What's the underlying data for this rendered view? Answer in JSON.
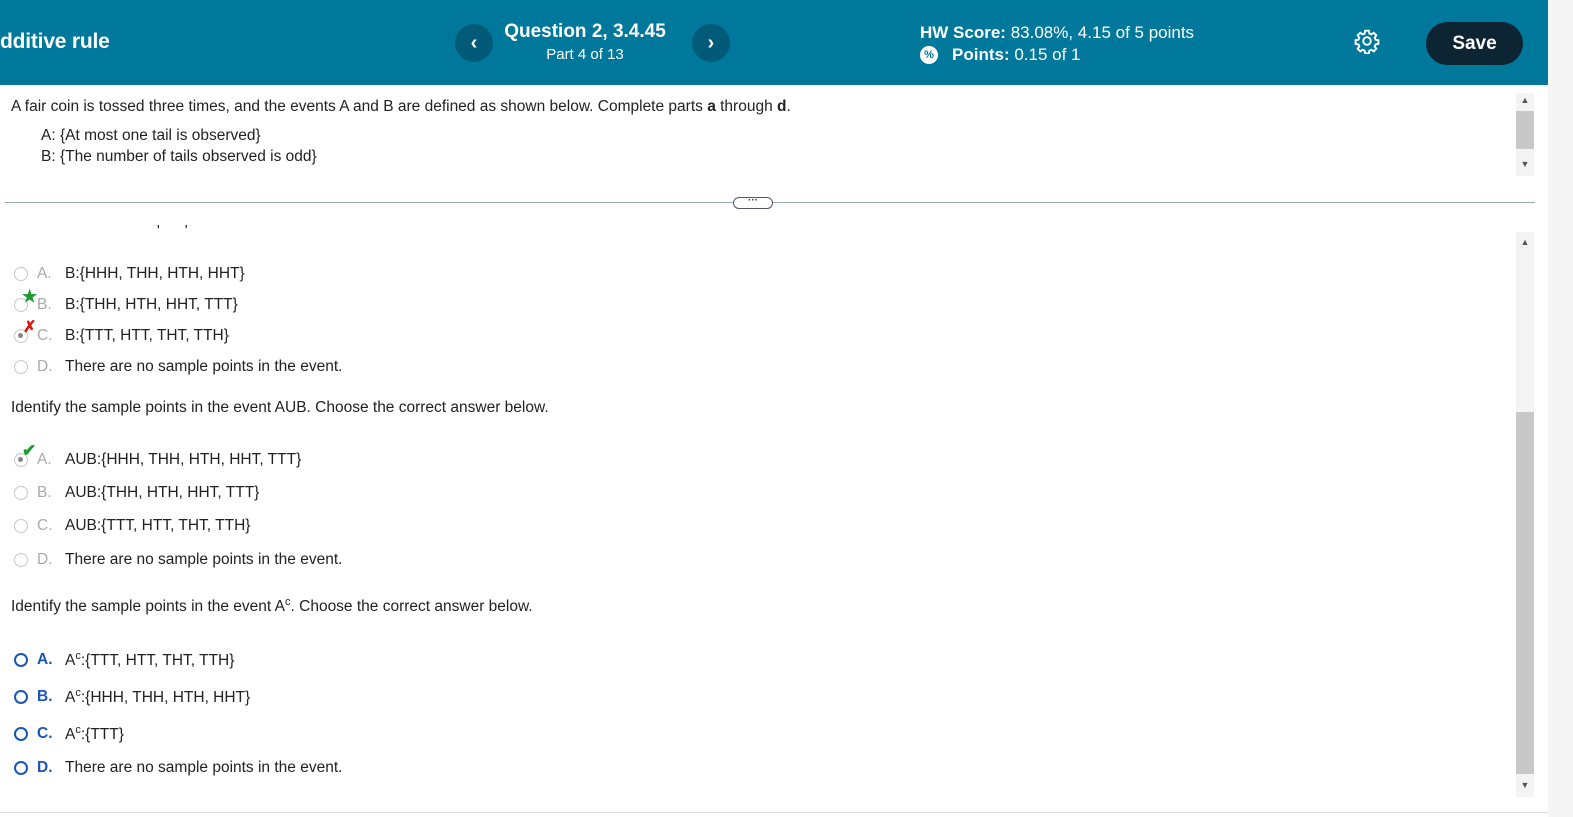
{
  "header": {
    "title": "dditive rule",
    "question_title": "Question 2, 3.4.45",
    "part": "Part 4 of 13",
    "hw_score_label": "HW Score:",
    "hw_score_value": "83.08%, 4.15 of 5 points",
    "points_label": "Points:",
    "points_value": "0.15 of 1",
    "prev_icon": "‹",
    "next_icon": "›",
    "save_label": "Save"
  },
  "problem": {
    "prompt_start": "A fair coin is tossed three times, and the events A and B are defined as shown below. Complete parts ",
    "prompt_a": "a",
    "prompt_mid": " through ",
    "prompt_d": "d",
    "prompt_end": ".",
    "event_a": "A: {At most one tail is observed}",
    "event_b": "B: {The number of tails observed is odd}"
  },
  "part_b": {
    "options": [
      {
        "letter": "A.",
        "text": "B:{HHH, THH, HTH, HHT}"
      },
      {
        "letter": "B.",
        "text": "B:{THH, HTH, HHT, TTT}"
      },
      {
        "letter": "C.",
        "text": "B:{TTT, HTT, THT, TTH}"
      },
      {
        "letter": "D.",
        "text": "There are no sample points in the event."
      }
    ]
  },
  "part_c": {
    "question": "Identify the sample points in the event AUB. Choose the correct answer below.",
    "options": [
      {
        "letter": "A.",
        "text": "AUB:{HHH, THH, HTH, HHT, TTT}"
      },
      {
        "letter": "B.",
        "text": "AUB:{THH, HTH, HHT, TTT}"
      },
      {
        "letter": "C.",
        "text": "AUB:{TTT, HTT, THT, TTH}"
      },
      {
        "letter": "D.",
        "text": "There are no sample points in the event."
      }
    ]
  },
  "part_d": {
    "question_start": "Identify the sample points in the event A",
    "question_sup": "c",
    "question_end": ". Choose the correct answer below.",
    "options": [
      {
        "letter": "A.",
        "pre": "A",
        "sup": "c",
        "text": ":{TTT, HTT, THT, TTH}"
      },
      {
        "letter": "B.",
        "pre": "A",
        "sup": "c",
        "text": ":{HHH, THH, HTH, HHT}"
      },
      {
        "letter": "C.",
        "pre": "A",
        "sup": "c",
        "text": ":{TTT}"
      },
      {
        "letter": "D.",
        "text": "There are no sample points in the event."
      }
    ]
  },
  "colors": {
    "header_bg": "#00789c",
    "save_bg": "#0d2533",
    "correct": "#1a9c2f",
    "incorrect": "#d8180c",
    "active_option": "#1a55b8"
  }
}
